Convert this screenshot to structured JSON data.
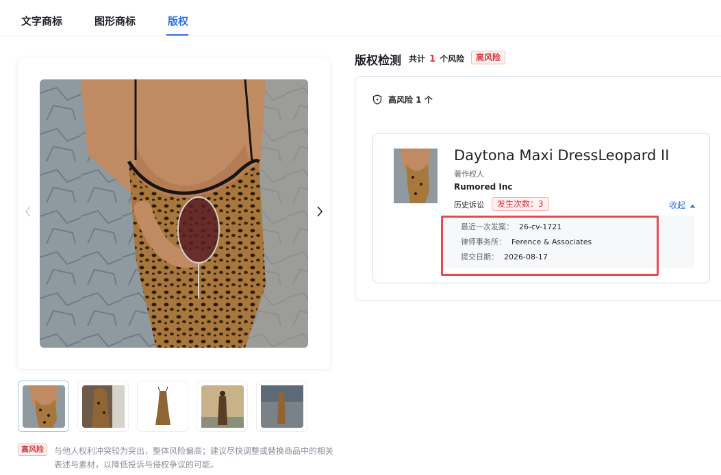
{
  "tabs": [
    {
      "label": "文字商标",
      "active": false
    },
    {
      "label": "图形商标",
      "active": false
    },
    {
      "label": "版权",
      "active": true
    }
  ],
  "gallery": {
    "prev_icon": "chevron-left-icon",
    "next_icon": "chevron-right-icon",
    "thumbnail_count": 5,
    "active_thumbnail": 1
  },
  "risk_note": {
    "badge": "高风险",
    "text": "与他人权利冲突较为突出，整体风险偏高；建议尽快调整或替换商品中的相关表述与素材，以降低投诉与侵权争议的可能。"
  },
  "copyright_check": {
    "title": "版权检测",
    "total_prefix": "共计",
    "total_count": "1",
    "total_suffix": "个风险",
    "risk_badge": "高风险",
    "summary": "高风险 1 个",
    "colors": {
      "accent": "#2f6fe4",
      "risk": "#d9363e",
      "highlight": "#e5484d"
    }
  },
  "item": {
    "title": "Daytona Maxi DressLeopard II",
    "owner_label": "著作权人",
    "owner": "Rumored Inc",
    "history_label": "历史诉讼",
    "occurrences": "发生次数：3",
    "collapse": "收起",
    "details": [
      {
        "label": "最近一次发案：",
        "value": "26-cv-1721"
      },
      {
        "label": "律师事务所：",
        "value": "Ference & Associates"
      },
      {
        "label": "提交日期：",
        "value": "2026-08-17"
      }
    ]
  }
}
